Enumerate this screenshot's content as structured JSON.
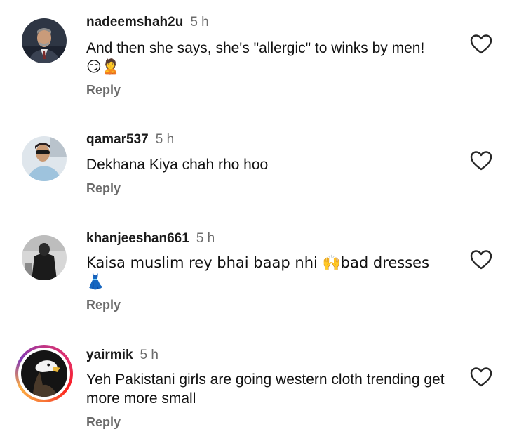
{
  "comments": [
    {
      "username": "nadeemshah2u",
      "time": "5 h",
      "text": "And then she says, she's \"allergic\" to winks by men!",
      "emoji_line": "😏🙎",
      "reply": "Reply",
      "avatar": "man-in-suit-avatar"
    },
    {
      "username": "qamar537",
      "time": "5 h",
      "text": "Dekhana Kiya chah rho hoo",
      "reply": "Reply",
      "avatar": "man-with-sunglasses-avatar"
    },
    {
      "username": "khanjeeshan661",
      "time": "5 h",
      "text": "Kaisa muslim rey bhai baap nhi 🙌bad dresses 👗",
      "emoji_line": "👗",
      "reply": "Reply",
      "avatar": "dark-portrait-avatar"
    },
    {
      "username": "yairmik",
      "time": "5 h",
      "text": "Yeh Pakistani girls are going western cloth trending get more more small",
      "reply": "Reply",
      "avatar": "eagle-avatar",
      "has_story_ring": true
    }
  ],
  "colors": {
    "text": "#111111",
    "muted": "#6b6b6b",
    "heart_stroke": "#262626"
  },
  "icons": {
    "like": "heart-outline-icon"
  }
}
